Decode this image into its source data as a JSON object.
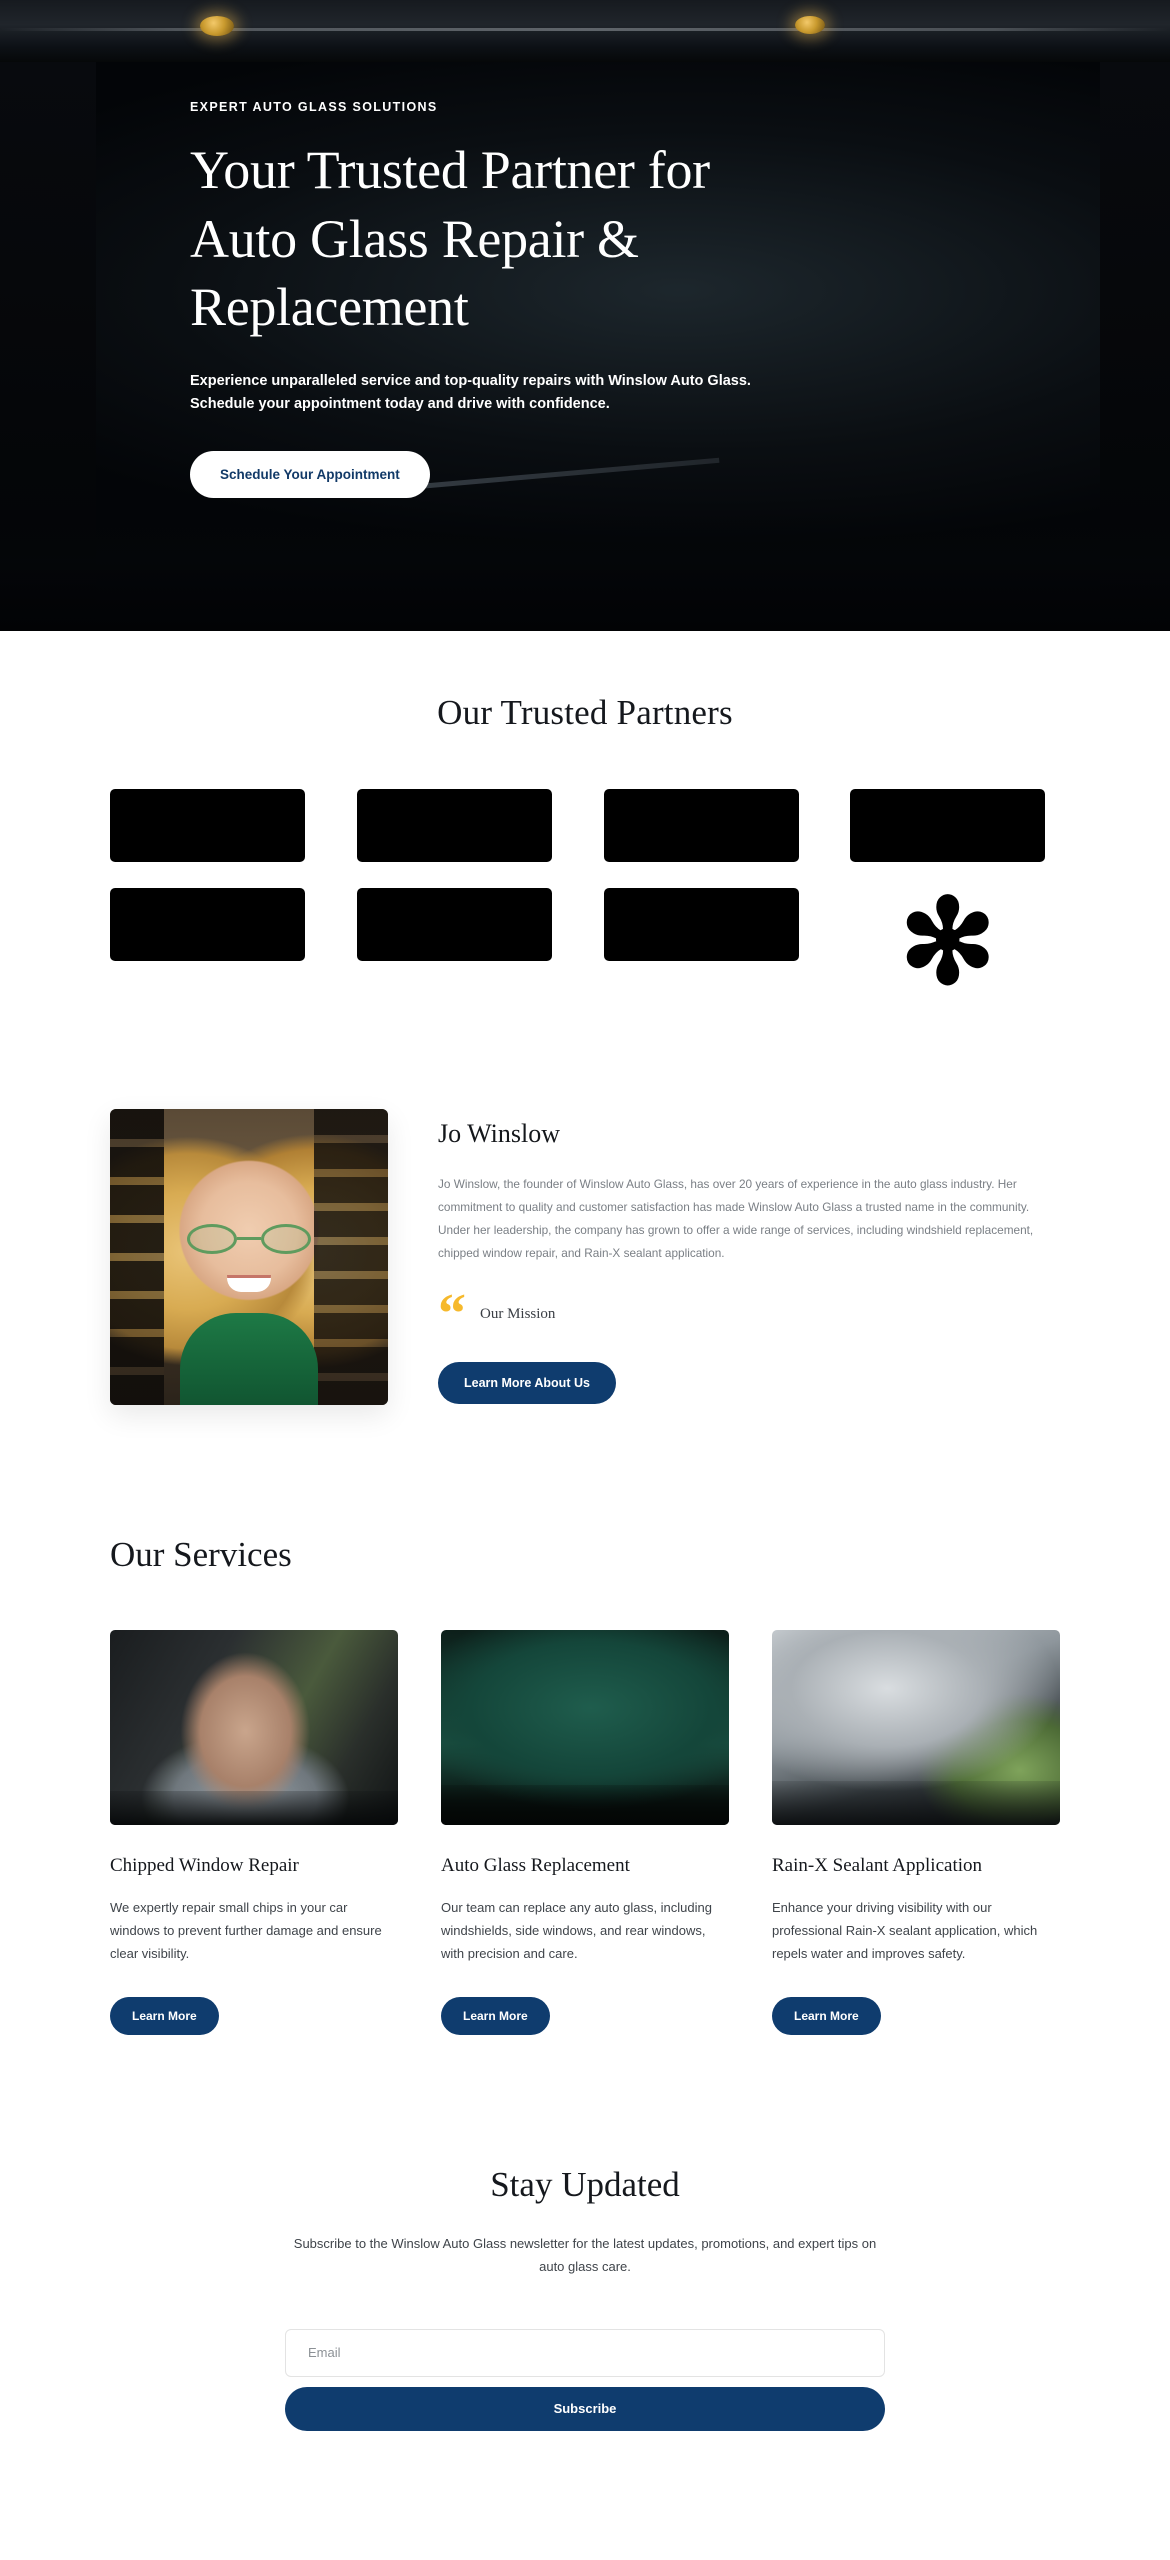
{
  "hero": {
    "eyebrow": "EXPERT AUTO GLASS SOLUTIONS",
    "title": "Your Trusted Partner for\nAuto Glass Repair &\nReplacement",
    "subtitle": "Experience unparalleled service and top-quality repairs with Winslow Auto Glass.\nSchedule your appointment today and drive with confidence.",
    "cta_label": "Schedule Your Appointment",
    "cta_text_color": "#123a68",
    "cta_bg_color": "#ffffff"
  },
  "partners": {
    "title": "Our Trusted Partners",
    "logos": [
      {
        "type": "block",
        "name": "partner-logo-1"
      },
      {
        "type": "block",
        "name": "partner-logo-2"
      },
      {
        "type": "block",
        "name": "partner-logo-3"
      },
      {
        "type": "block",
        "name": "partner-logo-4"
      },
      {
        "type": "block",
        "name": "partner-logo-5"
      },
      {
        "type": "block",
        "name": "partner-logo-6"
      },
      {
        "type": "block",
        "name": "partner-logo-7"
      },
      {
        "type": "asterisk",
        "name": "partner-logo-8",
        "glyph": "✻"
      }
    ]
  },
  "founder": {
    "name": "Jo Winslow",
    "bio": "Jo Winslow, the founder of Winslow Auto Glass, has over 20 years of experience in the auto glass industry. Her commitment to quality and customer satisfaction has made Winslow Auto Glass a trusted name in the community. Under her leadership, the company has grown to offer a wide range of services, including windshield replacement, chipped window repair, and Rain-X sealant application.",
    "quote_glyph": "“",
    "quote_color": "#f6b92c",
    "mission_label": "Our Mission",
    "cta_label": "Learn More About Us",
    "photo_alt": "Jo Winslow portrait"
  },
  "services": {
    "title": "Our Services",
    "cards": [
      {
        "name": "Chipped Window Repair",
        "description": "We expertly repair small chips in your car windows to prevent further damage and ensure clear visibility.",
        "cta_label": "Learn More",
        "image_alt": "Man leaning out of car window"
      },
      {
        "name": "Auto Glass Replacement",
        "description": "Our team can replace any auto glass, including windshields, side windows, and rear windows, with precision and care.",
        "cta_label": "Learn More",
        "image_alt": "Green car windshield close-up"
      },
      {
        "name": "Rain-X Sealant Application",
        "description": "Enhance your driving visibility with our professional Rain-X sealant application, which repels water and improves safety.",
        "cta_label": "Learn More",
        "image_alt": "Windshield with wipers and trees"
      }
    ]
  },
  "newsletter": {
    "title": "Stay Updated",
    "subtitle": "Subscribe to the Winslow Auto Glass newsletter for the latest updates, promotions, and expert tips on auto glass care.",
    "email_placeholder": "Email",
    "email_value": "",
    "submit_label": "Subscribe"
  },
  "theme": {
    "navy": "#0f3c6e",
    "amber": "#f6b92c",
    "ink": "#15181d",
    "muted": "#7a7f85"
  }
}
